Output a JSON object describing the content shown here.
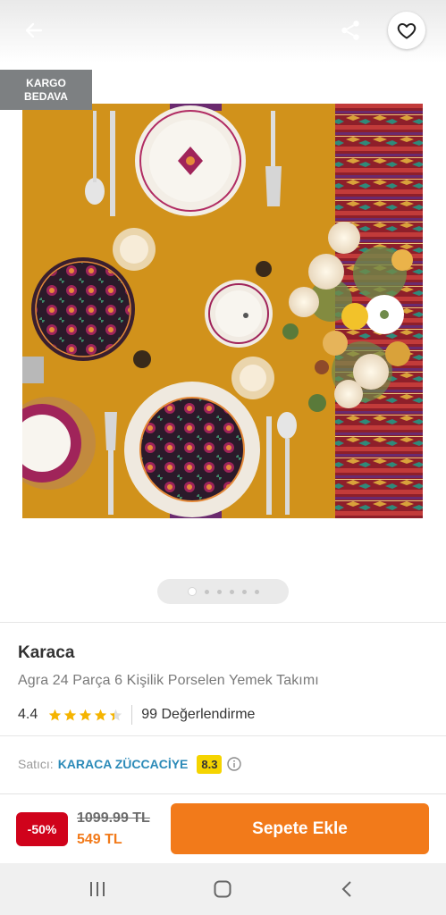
{
  "header": {
    "back_icon": "arrow-left-icon",
    "share_icon": "share-icon",
    "favorite_icon": "heart-icon"
  },
  "gallery": {
    "badge_line1": "KARGO",
    "badge_line2": "BEDAVA",
    "image_count": 6,
    "active_index": 0
  },
  "product": {
    "brand": "Karaca",
    "title": "Agra 24 Parça 6 Kişilik Porselen Yemek Takımı",
    "rating": "4.4",
    "rating_value": 4.4,
    "star_count": 5,
    "review_count": "99 Değerlendirme"
  },
  "seller": {
    "label": "Satıcı:",
    "name": "KARACA ZÜCCACİYE",
    "score": "8.3"
  },
  "purchase": {
    "discount": "-50%",
    "old_price": "1099.99 TL",
    "new_price": "549 TL",
    "add_to_cart": "Sepete Ekle"
  },
  "colors": {
    "accent": "#f27a1a",
    "discount": "#d0021b",
    "seller_link": "#2b8ab8",
    "score_badge": "#f5d400",
    "star": "#f5b400"
  }
}
